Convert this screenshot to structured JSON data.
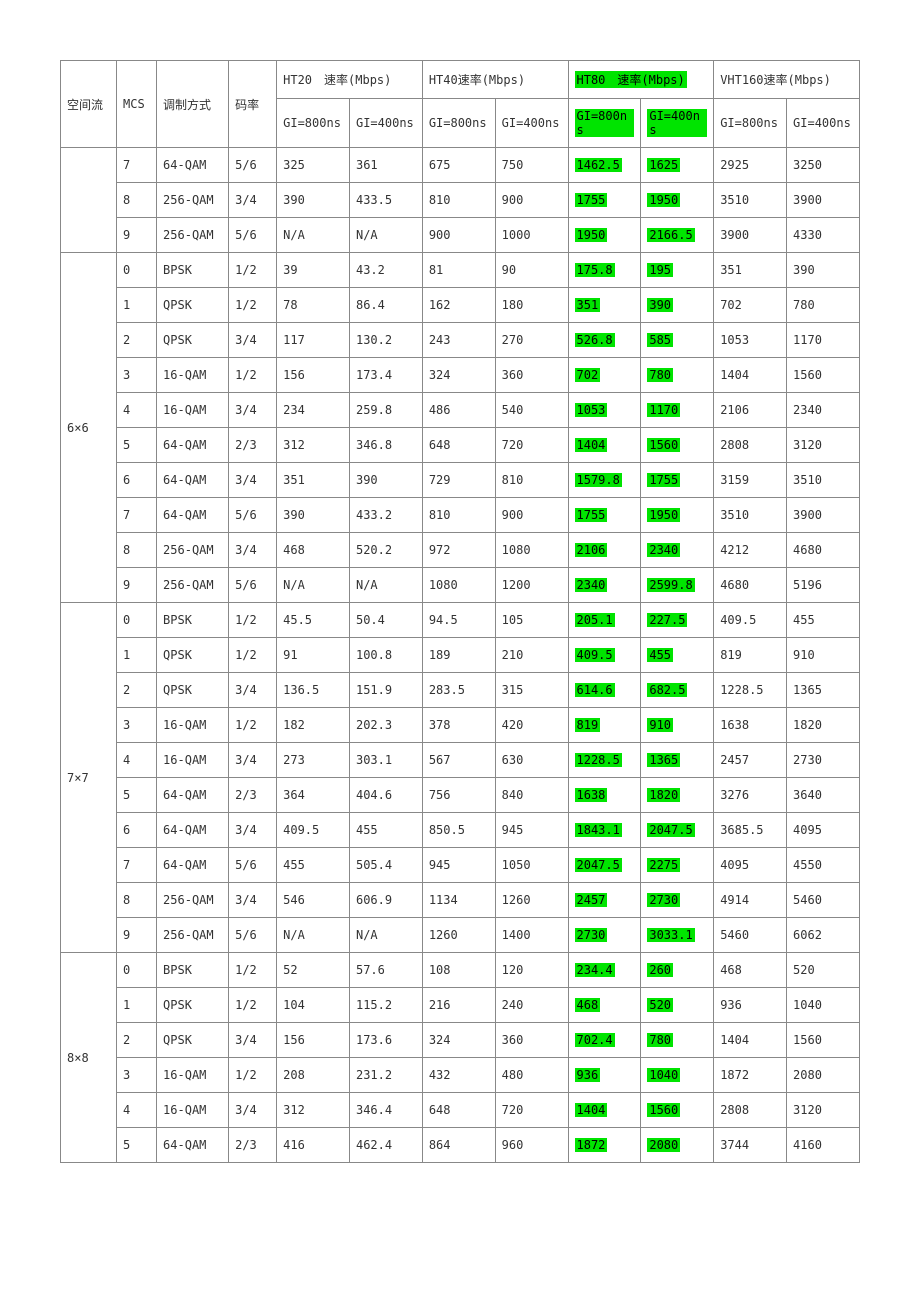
{
  "header": {
    "spatial_stream": "空间流",
    "mcs": "MCS",
    "modulation": "调制方式",
    "code_rate": "码率",
    "ht20": "HT20　速率(Mbps)",
    "ht40": "HT40速率(Mbps)",
    "ht80": "HT80　速率(Mbps)",
    "vht160": "VHT160速率(Mbps)",
    "gi800": "GI=800ns",
    "gi400": "GI=400ns"
  },
  "groups": [
    {
      "stream": "",
      "rows": [
        {
          "mcs": "7",
          "mod": "64-QAM",
          "code": "5/6",
          "ht20_800": "325",
          "ht20_400": "361",
          "ht40_800": "675",
          "ht40_400": "750",
          "ht80_800": "1462.5",
          "ht80_400": "1625",
          "vht160_800": "2925",
          "vht160_400": "3250"
        },
        {
          "mcs": "8",
          "mod": "256-QAM",
          "code": "3/4",
          "ht20_800": "390",
          "ht20_400": "433.5",
          "ht40_800": "810",
          "ht40_400": "900",
          "ht80_800": "1755",
          "ht80_400": "1950",
          "vht160_800": "3510",
          "vht160_400": "3900"
        },
        {
          "mcs": "9",
          "mod": "256-QAM",
          "code": "5/6",
          "ht20_800": "N/A",
          "ht20_400": "N/A",
          "ht40_800": "900",
          "ht40_400": "1000",
          "ht80_800": "1950",
          "ht80_400": "2166.5",
          "vht160_800": "3900",
          "vht160_400": "4330"
        }
      ]
    },
    {
      "stream": "6×6",
      "rows": [
        {
          "mcs": "0",
          "mod": "BPSK",
          "code": "1/2",
          "ht20_800": "39",
          "ht20_400": "43.2",
          "ht40_800": "81",
          "ht40_400": "90",
          "ht80_800": "175.8",
          "ht80_400": "195",
          "vht160_800": "351",
          "vht160_400": "390"
        },
        {
          "mcs": "1",
          "mod": "QPSK",
          "code": "1/2",
          "ht20_800": "78",
          "ht20_400": "86.4",
          "ht40_800": "162",
          "ht40_400": "180",
          "ht80_800": "351",
          "ht80_400": "390",
          "vht160_800": "702",
          "vht160_400": "780"
        },
        {
          "mcs": "2",
          "mod": "QPSK",
          "code": "3/4",
          "ht20_800": "117",
          "ht20_400": "130.2",
          "ht40_800": "243",
          "ht40_400": "270",
          "ht80_800": "526.8",
          "ht80_400": "585",
          "vht160_800": "1053",
          "vht160_400": "1170"
        },
        {
          "mcs": "3",
          "mod": "16-QAM",
          "code": "1/2",
          "ht20_800": "156",
          "ht20_400": "173.4",
          "ht40_800": "324",
          "ht40_400": "360",
          "ht80_800": "702",
          "ht80_400": "780",
          "vht160_800": "1404",
          "vht160_400": "1560"
        },
        {
          "mcs": "4",
          "mod": "16-QAM",
          "code": "3/4",
          "ht20_800": "234",
          "ht20_400": "259.8",
          "ht40_800": "486",
          "ht40_400": "540",
          "ht80_800": "1053",
          "ht80_400": "1170",
          "vht160_800": "2106",
          "vht160_400": "2340"
        },
        {
          "mcs": "5",
          "mod": "64-QAM",
          "code": "2/3",
          "ht20_800": "312",
          "ht20_400": "346.8",
          "ht40_800": "648",
          "ht40_400": "720",
          "ht80_800": "1404",
          "ht80_400": "1560",
          "vht160_800": "2808",
          "vht160_400": "3120"
        },
        {
          "mcs": "6",
          "mod": "64-QAM",
          "code": "3/4",
          "ht20_800": "351",
          "ht20_400": "390",
          "ht40_800": "729",
          "ht40_400": "810",
          "ht80_800": "1579.8",
          "ht80_400": "1755",
          "vht160_800": "3159",
          "vht160_400": "3510"
        },
        {
          "mcs": "7",
          "mod": "64-QAM",
          "code": "5/6",
          "ht20_800": "390",
          "ht20_400": "433.2",
          "ht40_800": "810",
          "ht40_400": "900",
          "ht80_800": "1755",
          "ht80_400": "1950",
          "vht160_800": "3510",
          "vht160_400": "3900"
        },
        {
          "mcs": "8",
          "mod": "256-QAM",
          "code": "3/4",
          "ht20_800": "468",
          "ht20_400": "520.2",
          "ht40_800": "972",
          "ht40_400": "1080",
          "ht80_800": "2106",
          "ht80_400": "2340",
          "vht160_800": "4212",
          "vht160_400": "4680"
        },
        {
          "mcs": "9",
          "mod": "256-QAM",
          "code": "5/6",
          "ht20_800": "N/A",
          "ht20_400": "N/A",
          "ht40_800": "1080",
          "ht40_400": "1200",
          "ht80_800": "2340",
          "ht80_400": "2599.8",
          "vht160_800": "4680",
          "vht160_400": "5196"
        }
      ]
    },
    {
      "stream": "7×7",
      "rows": [
        {
          "mcs": "0",
          "mod": "BPSK",
          "code": "1/2",
          "ht20_800": "45.5",
          "ht20_400": "50.4",
          "ht40_800": "94.5",
          "ht40_400": "105",
          "ht80_800": "205.1",
          "ht80_400": "227.5",
          "vht160_800": "409.5",
          "vht160_400": "455"
        },
        {
          "mcs": "1",
          "mod": "QPSK",
          "code": "1/2",
          "ht20_800": "91",
          "ht20_400": "100.8",
          "ht40_800": "189",
          "ht40_400": "210",
          "ht80_800": "409.5",
          "ht80_400": "455",
          "vht160_800": "819",
          "vht160_400": "910"
        },
        {
          "mcs": "2",
          "mod": "QPSK",
          "code": "3/4",
          "ht20_800": "136.5",
          "ht20_400": "151.9",
          "ht40_800": "283.5",
          "ht40_400": "315",
          "ht80_800": "614.6",
          "ht80_400": "682.5",
          "vht160_800": "1228.5",
          "vht160_400": "1365"
        },
        {
          "mcs": "3",
          "mod": "16-QAM",
          "code": "1/2",
          "ht20_800": "182",
          "ht20_400": "202.3",
          "ht40_800": "378",
          "ht40_400": "420",
          "ht80_800": "819",
          "ht80_400": "910",
          "vht160_800": "1638",
          "vht160_400": "1820"
        },
        {
          "mcs": "4",
          "mod": "16-QAM",
          "code": "3/4",
          "ht20_800": "273",
          "ht20_400": "303.1",
          "ht40_800": "567",
          "ht40_400": "630",
          "ht80_800": "1228.5",
          "ht80_400": "1365",
          "vht160_800": "2457",
          "vht160_400": "2730"
        },
        {
          "mcs": "5",
          "mod": "64-QAM",
          "code": "2/3",
          "ht20_800": "364",
          "ht20_400": "404.6",
          "ht40_800": "756",
          "ht40_400": "840",
          "ht80_800": "1638",
          "ht80_400": "1820",
          "vht160_800": "3276",
          "vht160_400": "3640"
        },
        {
          "mcs": "6",
          "mod": "64-QAM",
          "code": "3/4",
          "ht20_800": "409.5",
          "ht20_400": "455",
          "ht40_800": "850.5",
          "ht40_400": "945",
          "ht80_800": "1843.1",
          "ht80_400": "2047.5",
          "vht160_800": "3685.5",
          "vht160_400": "4095"
        },
        {
          "mcs": "7",
          "mod": "64-QAM",
          "code": "5/6",
          "ht20_800": "455",
          "ht20_400": "505.4",
          "ht40_800": "945",
          "ht40_400": "1050",
          "ht80_800": "2047.5",
          "ht80_400": "2275",
          "vht160_800": "4095",
          "vht160_400": "4550"
        },
        {
          "mcs": "8",
          "mod": "256-QAM",
          "code": "3/4",
          "ht20_800": "546",
          "ht20_400": "606.9",
          "ht40_800": "1134",
          "ht40_400": "1260",
          "ht80_800": "2457",
          "ht80_400": "2730",
          "vht160_800": "4914",
          "vht160_400": "5460"
        },
        {
          "mcs": "9",
          "mod": "256-QAM",
          "code": "5/6",
          "ht20_800": "N/A",
          "ht20_400": "N/A",
          "ht40_800": "1260",
          "ht40_400": "1400",
          "ht80_800": "2730",
          "ht80_400": "3033.1",
          "vht160_800": "5460",
          "vht160_400": "6062"
        }
      ]
    },
    {
      "stream": "8×8",
      "rows": [
        {
          "mcs": "0",
          "mod": "BPSK",
          "code": "1/2",
          "ht20_800": "52",
          "ht20_400": "57.6",
          "ht40_800": "108",
          "ht40_400": "120",
          "ht80_800": "234.4",
          "ht80_400": "260",
          "vht160_800": "468",
          "vht160_400": "520"
        },
        {
          "mcs": "1",
          "mod": "QPSK",
          "code": "1/2",
          "ht20_800": "104",
          "ht20_400": "115.2",
          "ht40_800": "216",
          "ht40_400": "240",
          "ht80_800": "468",
          "ht80_400": "520",
          "vht160_800": "936",
          "vht160_400": "1040"
        },
        {
          "mcs": "2",
          "mod": "QPSK",
          "code": "3/4",
          "ht20_800": "156",
          "ht20_400": "173.6",
          "ht40_800": "324",
          "ht40_400": "360",
          "ht80_800": "702.4",
          "ht80_400": "780",
          "vht160_800": "1404",
          "vht160_400": "1560"
        },
        {
          "mcs": "3",
          "mod": "16-QAM",
          "code": "1/2",
          "ht20_800": "208",
          "ht20_400": "231.2",
          "ht40_800": "432",
          "ht40_400": "480",
          "ht80_800": "936",
          "ht80_400": "1040",
          "vht160_800": "1872",
          "vht160_400": "2080"
        },
        {
          "mcs": "4",
          "mod": "16-QAM",
          "code": "3/4",
          "ht20_800": "312",
          "ht20_400": "346.4",
          "ht40_800": "648",
          "ht40_400": "720",
          "ht80_800": "1404",
          "ht80_400": "1560",
          "vht160_800": "2808",
          "vht160_400": "3120"
        },
        {
          "mcs": "5",
          "mod": "64-QAM",
          "code": "2/3",
          "ht20_800": "416",
          "ht20_400": "462.4",
          "ht40_800": "864",
          "ht40_400": "960",
          "ht80_800": "1872",
          "ht80_400": "2080",
          "vht160_800": "3744",
          "vht160_400": "4160"
        }
      ]
    }
  ]
}
